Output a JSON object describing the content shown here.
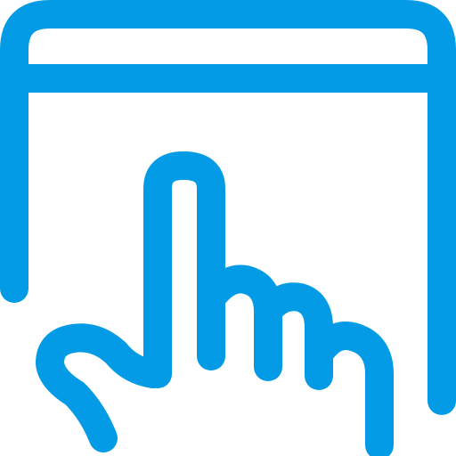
{
  "icon": {
    "name": "touch-screen-icon",
    "parts": [
      "browser-window-icon",
      "pointing-hand-icon"
    ],
    "color": "#039BE5",
    "background": "#FFFFFF"
  }
}
